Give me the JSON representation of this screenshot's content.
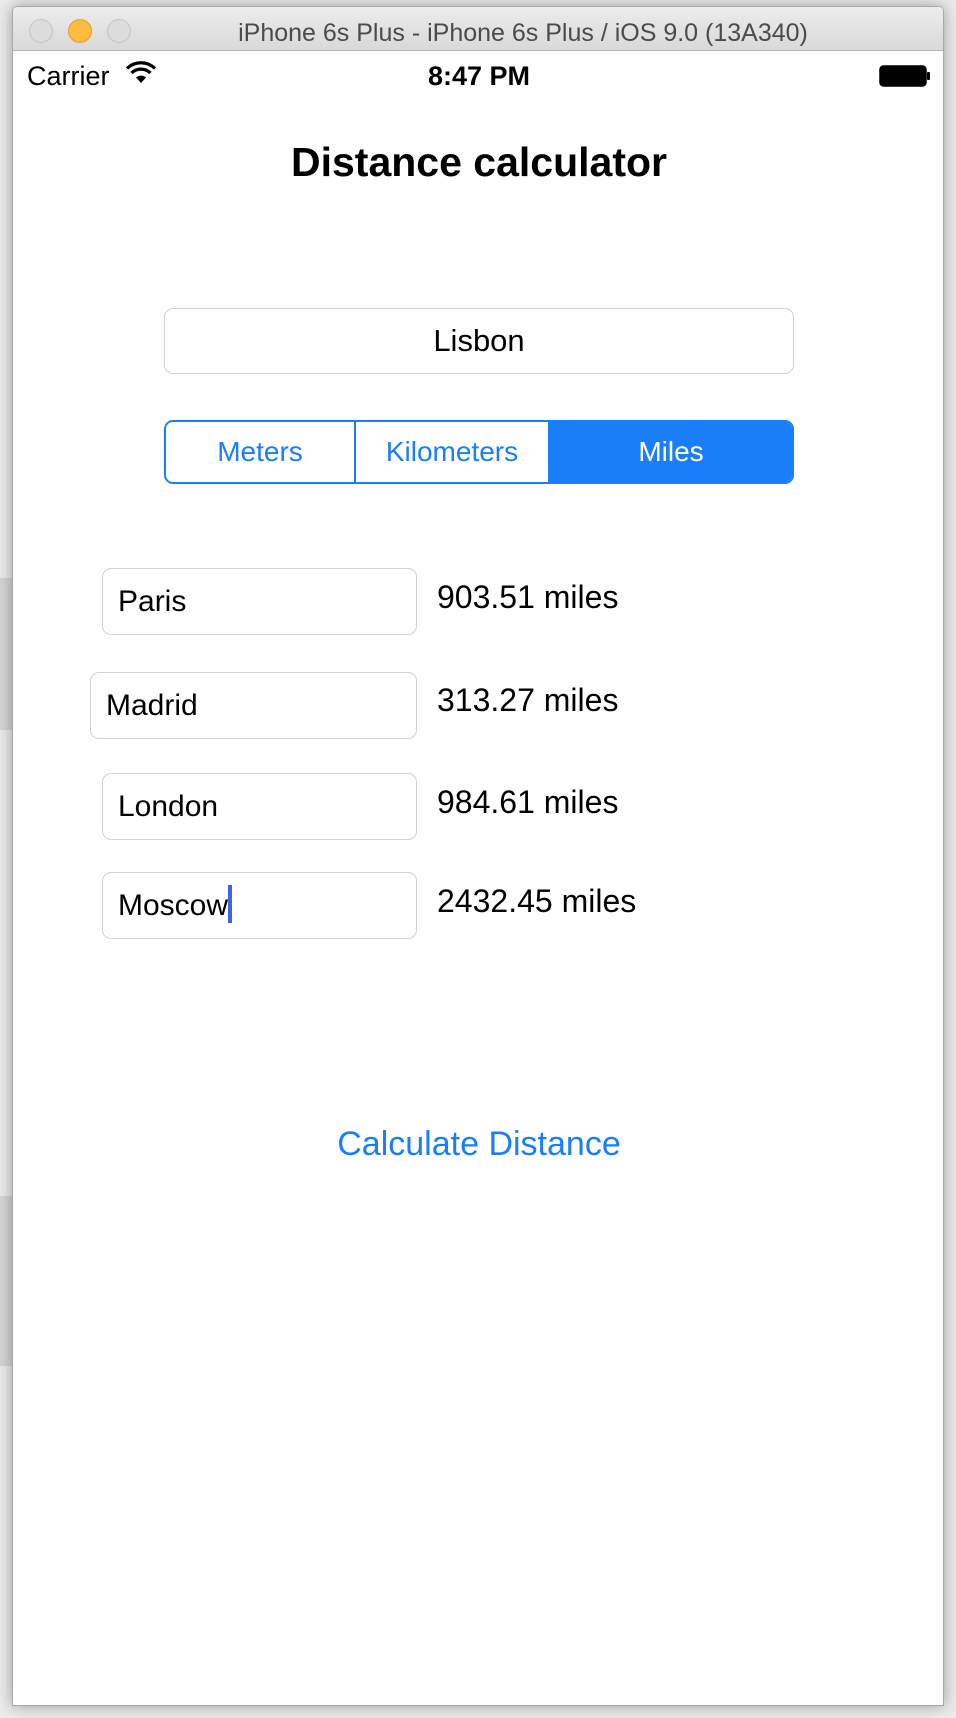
{
  "window": {
    "title": "iPhone 6s Plus - iPhone 6s Plus / iOS 9.0 (13A340)"
  },
  "status_bar": {
    "carrier": "Carrier",
    "time": "8:47 PM"
  },
  "app": {
    "title": "Distance calculator",
    "origin_value": "Lisbon",
    "units": {
      "options": [
        "Meters",
        "Kilometers",
        "Miles"
      ],
      "selected": "Miles"
    },
    "destinations": [
      {
        "city": "Paris",
        "distance": "903.51 miles"
      },
      {
        "city": "Madrid",
        "distance": "313.27 miles"
      },
      {
        "city": "London",
        "distance": "984.61 miles"
      },
      {
        "city": "Moscow",
        "distance": "2432.45 miles"
      }
    ],
    "calculate_label": "Calculate Distance"
  },
  "colors": {
    "accent": "#1a7ef8",
    "caret": "#3f63e6",
    "minimize_button": "#fdbc40"
  }
}
